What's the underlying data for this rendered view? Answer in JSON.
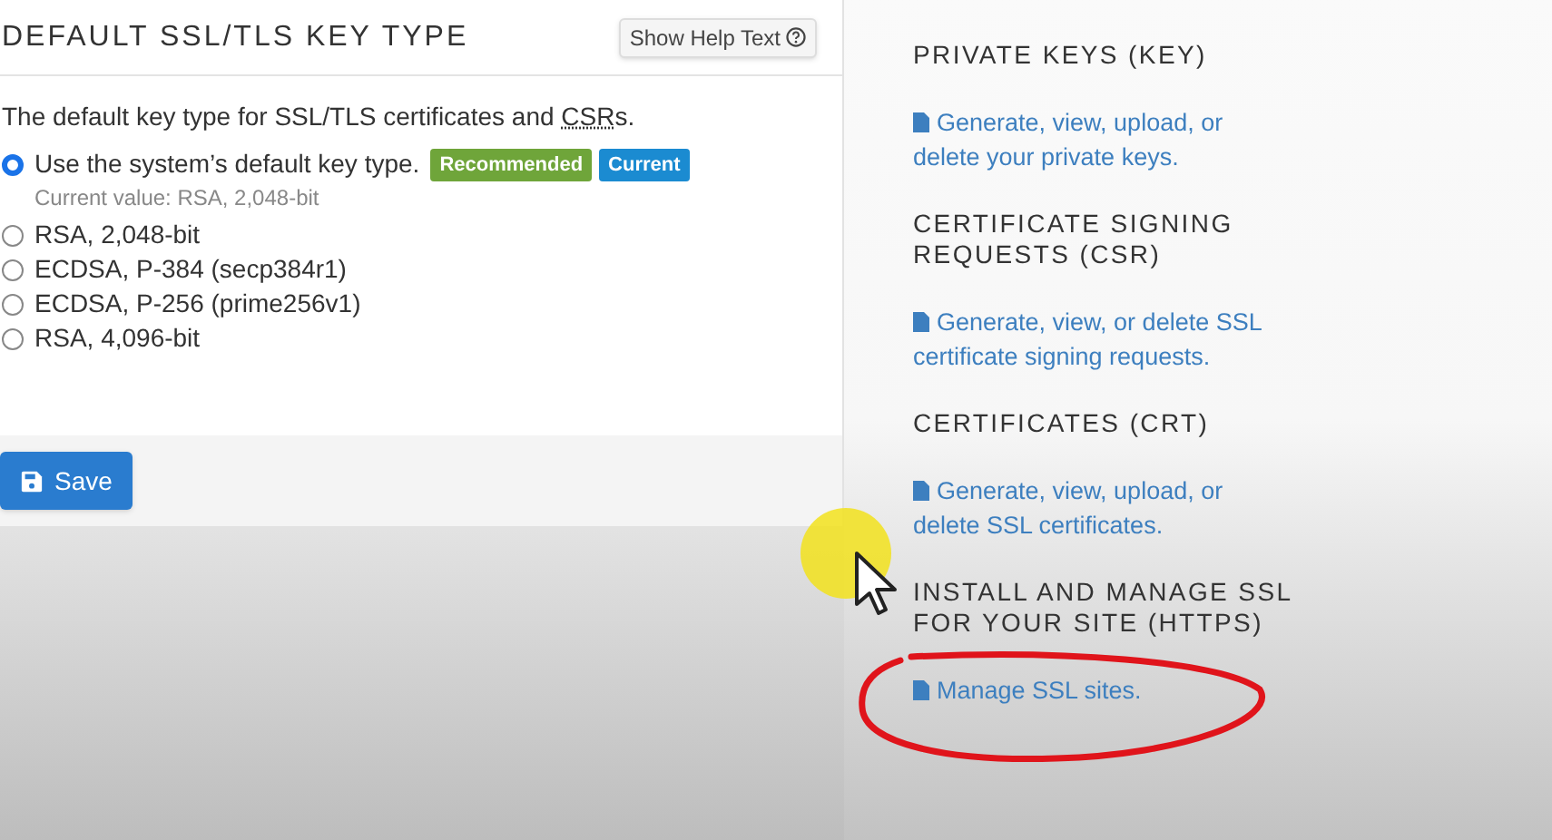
{
  "key_type_panel": {
    "title": "DEFAULT SSL/TLS KEY TYPE",
    "help_button": "Show Help Text",
    "description": {
      "before": "The default key type for SSL/TLS certificates and ",
      "abbr": "CSR",
      "after": "s."
    },
    "options": [
      {
        "label": "Use the system’s default key type.",
        "selected": true,
        "note": "Current value: RSA, 2,048-bit",
        "badges": [
          {
            "text": "Recommended",
            "color": "#6fa53a"
          },
          {
            "text": "Current",
            "color": "#1b8bd1"
          }
        ]
      },
      {
        "label": "RSA, 2,048-bit",
        "selected": false
      },
      {
        "label": "ECDSA, P-384 (secp384r1)",
        "selected": false
      },
      {
        "label": "ECDSA, P-256 (prime256v1)",
        "selected": false
      },
      {
        "label": "RSA, 4,096-bit",
        "selected": false
      }
    ],
    "save_button": "Save"
  },
  "sidebar": {
    "sections": [
      {
        "title": "PRIVATE KEYS (KEY)",
        "link": "Generate, view, upload, or delete your private keys."
      },
      {
        "title": "CERTIFICATE SIGNING REQUESTS (CSR)",
        "link": "Generate, view, or delete SSL certificate signing requests."
      },
      {
        "title": "CERTIFICATES (CRT)",
        "link": "Generate, view, upload, or delete SSL certificates."
      },
      {
        "title": "INSTALL AND MANAGE SSL FOR YOUR SITE (HTTPS)",
        "link": "Manage SSL sites."
      }
    ]
  }
}
